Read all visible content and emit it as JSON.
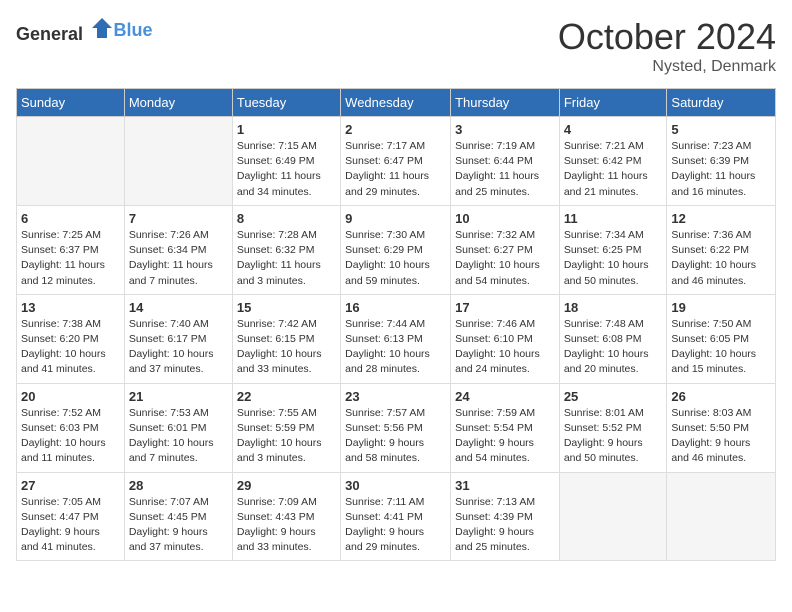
{
  "logo": {
    "general": "General",
    "blue": "Blue"
  },
  "title": "October 2024",
  "location": "Nysted, Denmark",
  "days_header": [
    "Sunday",
    "Monday",
    "Tuesday",
    "Wednesday",
    "Thursday",
    "Friday",
    "Saturday"
  ],
  "weeks": [
    [
      {
        "day": "",
        "info": ""
      },
      {
        "day": "",
        "info": ""
      },
      {
        "day": "1",
        "info": "Sunrise: 7:15 AM\nSunset: 6:49 PM\nDaylight: 11 hours\nand 34 minutes."
      },
      {
        "day": "2",
        "info": "Sunrise: 7:17 AM\nSunset: 6:47 PM\nDaylight: 11 hours\nand 29 minutes."
      },
      {
        "day": "3",
        "info": "Sunrise: 7:19 AM\nSunset: 6:44 PM\nDaylight: 11 hours\nand 25 minutes."
      },
      {
        "day": "4",
        "info": "Sunrise: 7:21 AM\nSunset: 6:42 PM\nDaylight: 11 hours\nand 21 minutes."
      },
      {
        "day": "5",
        "info": "Sunrise: 7:23 AM\nSunset: 6:39 PM\nDaylight: 11 hours\nand 16 minutes."
      }
    ],
    [
      {
        "day": "6",
        "info": "Sunrise: 7:25 AM\nSunset: 6:37 PM\nDaylight: 11 hours\nand 12 minutes."
      },
      {
        "day": "7",
        "info": "Sunrise: 7:26 AM\nSunset: 6:34 PM\nDaylight: 11 hours\nand 7 minutes."
      },
      {
        "day": "8",
        "info": "Sunrise: 7:28 AM\nSunset: 6:32 PM\nDaylight: 11 hours\nand 3 minutes."
      },
      {
        "day": "9",
        "info": "Sunrise: 7:30 AM\nSunset: 6:29 PM\nDaylight: 10 hours\nand 59 minutes."
      },
      {
        "day": "10",
        "info": "Sunrise: 7:32 AM\nSunset: 6:27 PM\nDaylight: 10 hours\nand 54 minutes."
      },
      {
        "day": "11",
        "info": "Sunrise: 7:34 AM\nSunset: 6:25 PM\nDaylight: 10 hours\nand 50 minutes."
      },
      {
        "day": "12",
        "info": "Sunrise: 7:36 AM\nSunset: 6:22 PM\nDaylight: 10 hours\nand 46 minutes."
      }
    ],
    [
      {
        "day": "13",
        "info": "Sunrise: 7:38 AM\nSunset: 6:20 PM\nDaylight: 10 hours\nand 41 minutes."
      },
      {
        "day": "14",
        "info": "Sunrise: 7:40 AM\nSunset: 6:17 PM\nDaylight: 10 hours\nand 37 minutes."
      },
      {
        "day": "15",
        "info": "Sunrise: 7:42 AM\nSunset: 6:15 PM\nDaylight: 10 hours\nand 33 minutes."
      },
      {
        "day": "16",
        "info": "Sunrise: 7:44 AM\nSunset: 6:13 PM\nDaylight: 10 hours\nand 28 minutes."
      },
      {
        "day": "17",
        "info": "Sunrise: 7:46 AM\nSunset: 6:10 PM\nDaylight: 10 hours\nand 24 minutes."
      },
      {
        "day": "18",
        "info": "Sunrise: 7:48 AM\nSunset: 6:08 PM\nDaylight: 10 hours\nand 20 minutes."
      },
      {
        "day": "19",
        "info": "Sunrise: 7:50 AM\nSunset: 6:05 PM\nDaylight: 10 hours\nand 15 minutes."
      }
    ],
    [
      {
        "day": "20",
        "info": "Sunrise: 7:52 AM\nSunset: 6:03 PM\nDaylight: 10 hours\nand 11 minutes."
      },
      {
        "day": "21",
        "info": "Sunrise: 7:53 AM\nSunset: 6:01 PM\nDaylight: 10 hours\nand 7 minutes."
      },
      {
        "day": "22",
        "info": "Sunrise: 7:55 AM\nSunset: 5:59 PM\nDaylight: 10 hours\nand 3 minutes."
      },
      {
        "day": "23",
        "info": "Sunrise: 7:57 AM\nSunset: 5:56 PM\nDaylight: 9 hours\nand 58 minutes."
      },
      {
        "day": "24",
        "info": "Sunrise: 7:59 AM\nSunset: 5:54 PM\nDaylight: 9 hours\nand 54 minutes."
      },
      {
        "day": "25",
        "info": "Sunrise: 8:01 AM\nSunset: 5:52 PM\nDaylight: 9 hours\nand 50 minutes."
      },
      {
        "day": "26",
        "info": "Sunrise: 8:03 AM\nSunset: 5:50 PM\nDaylight: 9 hours\nand 46 minutes."
      }
    ],
    [
      {
        "day": "27",
        "info": "Sunrise: 7:05 AM\nSunset: 4:47 PM\nDaylight: 9 hours\nand 41 minutes."
      },
      {
        "day": "28",
        "info": "Sunrise: 7:07 AM\nSunset: 4:45 PM\nDaylight: 9 hours\nand 37 minutes."
      },
      {
        "day": "29",
        "info": "Sunrise: 7:09 AM\nSunset: 4:43 PM\nDaylight: 9 hours\nand 33 minutes."
      },
      {
        "day": "30",
        "info": "Sunrise: 7:11 AM\nSunset: 4:41 PM\nDaylight: 9 hours\nand 29 minutes."
      },
      {
        "day": "31",
        "info": "Sunrise: 7:13 AM\nSunset: 4:39 PM\nDaylight: 9 hours\nand 25 minutes."
      },
      {
        "day": "",
        "info": ""
      },
      {
        "day": "",
        "info": ""
      }
    ]
  ]
}
